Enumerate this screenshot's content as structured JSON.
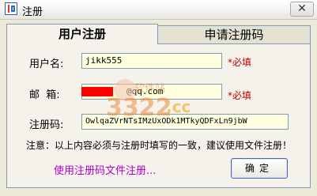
{
  "window": {
    "title": "注册",
    "close_label": "✕"
  },
  "tabs": [
    {
      "label": "用户注册",
      "active": true
    },
    {
      "label": "申请注册码",
      "active": false
    }
  ],
  "form": {
    "username_label": "用户名:",
    "username_value": "jikk555",
    "email_label": "邮  箱:",
    "email_value": "@qq.com",
    "regcode_label": "注册码:",
    "regcode_value": "OwlqaZVrNTsIMzUxODk1MTkyQDFxLn9jbW",
    "required_text": "*必填"
  },
  "notice": "注意：以上内容必须与注册时填写的一致，建议使用文件注册！",
  "file_register_link": "使用注册码文件注册...",
  "ok_button": "确定",
  "watermark": {
    "text1": "3322",
    "text2": ".cc",
    "text3": "软件站"
  },
  "colors": {
    "required": "#c00000",
    "link": "#b000c8",
    "field_bg": "#ffffe0"
  }
}
